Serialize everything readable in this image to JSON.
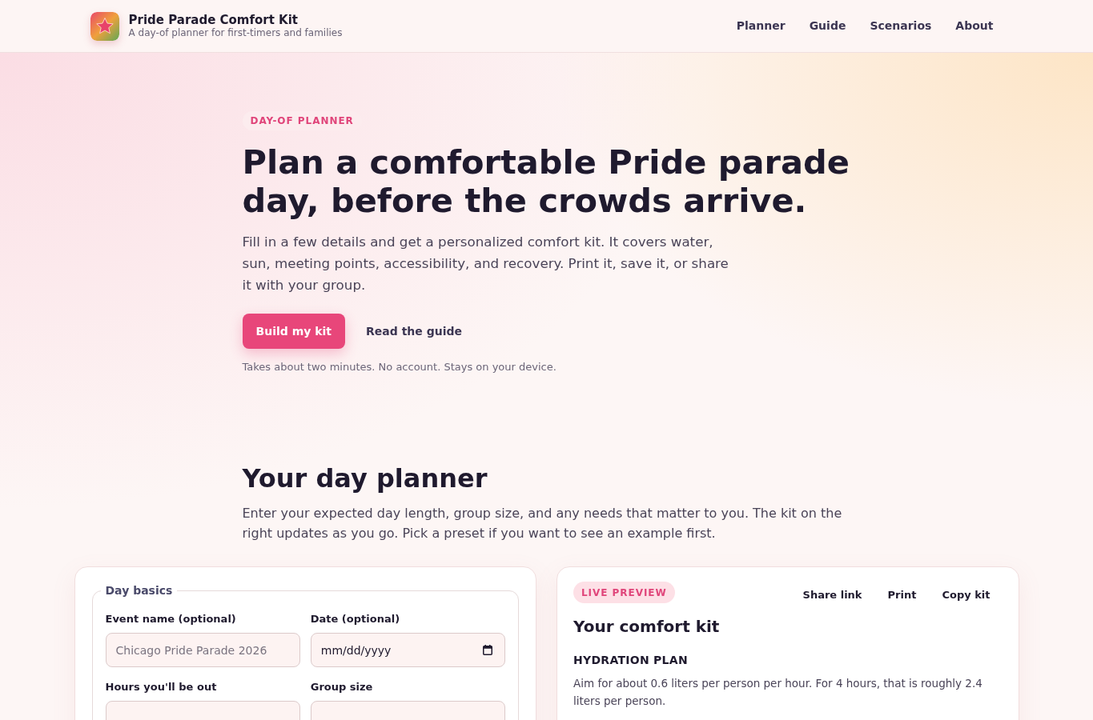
{
  "header": {
    "title": "Pride Parade Comfort Kit",
    "subtitle": "A day-of planner for first-timers and families",
    "nav": [
      "Planner",
      "Guide",
      "Scenarios",
      "About"
    ]
  },
  "hero": {
    "eyebrow": "DAY-OF PLANNER",
    "heading": "Plan a comfortable Pride parade day, before the crowds arrive.",
    "intro": "Fill in a few details and get a personalized comfort kit. It covers water, sun, meeting points, accessibility, and recovery. Print it, save it, or share it with your group.",
    "actions": [
      {
        "label": "Build my kit",
        "kind": "primary"
      },
      {
        "label": "Read the guide",
        "kind": "secondary"
      }
    ],
    "note": "Takes about two minutes. No account. Stays on your device."
  },
  "planner": {
    "heading": "Your day planner",
    "intro": "Enter your expected day length, group size, and any needs that matter to you. The kit on the right updates as you go. Pick a preset if you want to see an example first.",
    "form": {
      "legend": "Day basics",
      "fields": [
        {
          "label": "Event name (optional)",
          "kind": "text",
          "placeholder": "Chicago Pride Parade 2026"
        },
        {
          "label": "Date (optional)",
          "kind": "date",
          "placeholder": "mm/dd/yyyy"
        },
        {
          "label": "Hours you'll be out",
          "kind": "number"
        },
        {
          "label": "Group size",
          "kind": "number"
        }
      ]
    },
    "preview": {
      "badge": "LIVE PREVIEW",
      "actions": [
        "Share link",
        "Print",
        "Copy kit"
      ],
      "title": "Your comfort kit",
      "sections": [
        {
          "heading": "HYDRATION PLAN",
          "paragraphs": [
            "Aim for about 0.6 liters per person per hour. For 4 hours, that is roughly 2.4 liters per person."
          ]
        }
      ]
    }
  }
}
